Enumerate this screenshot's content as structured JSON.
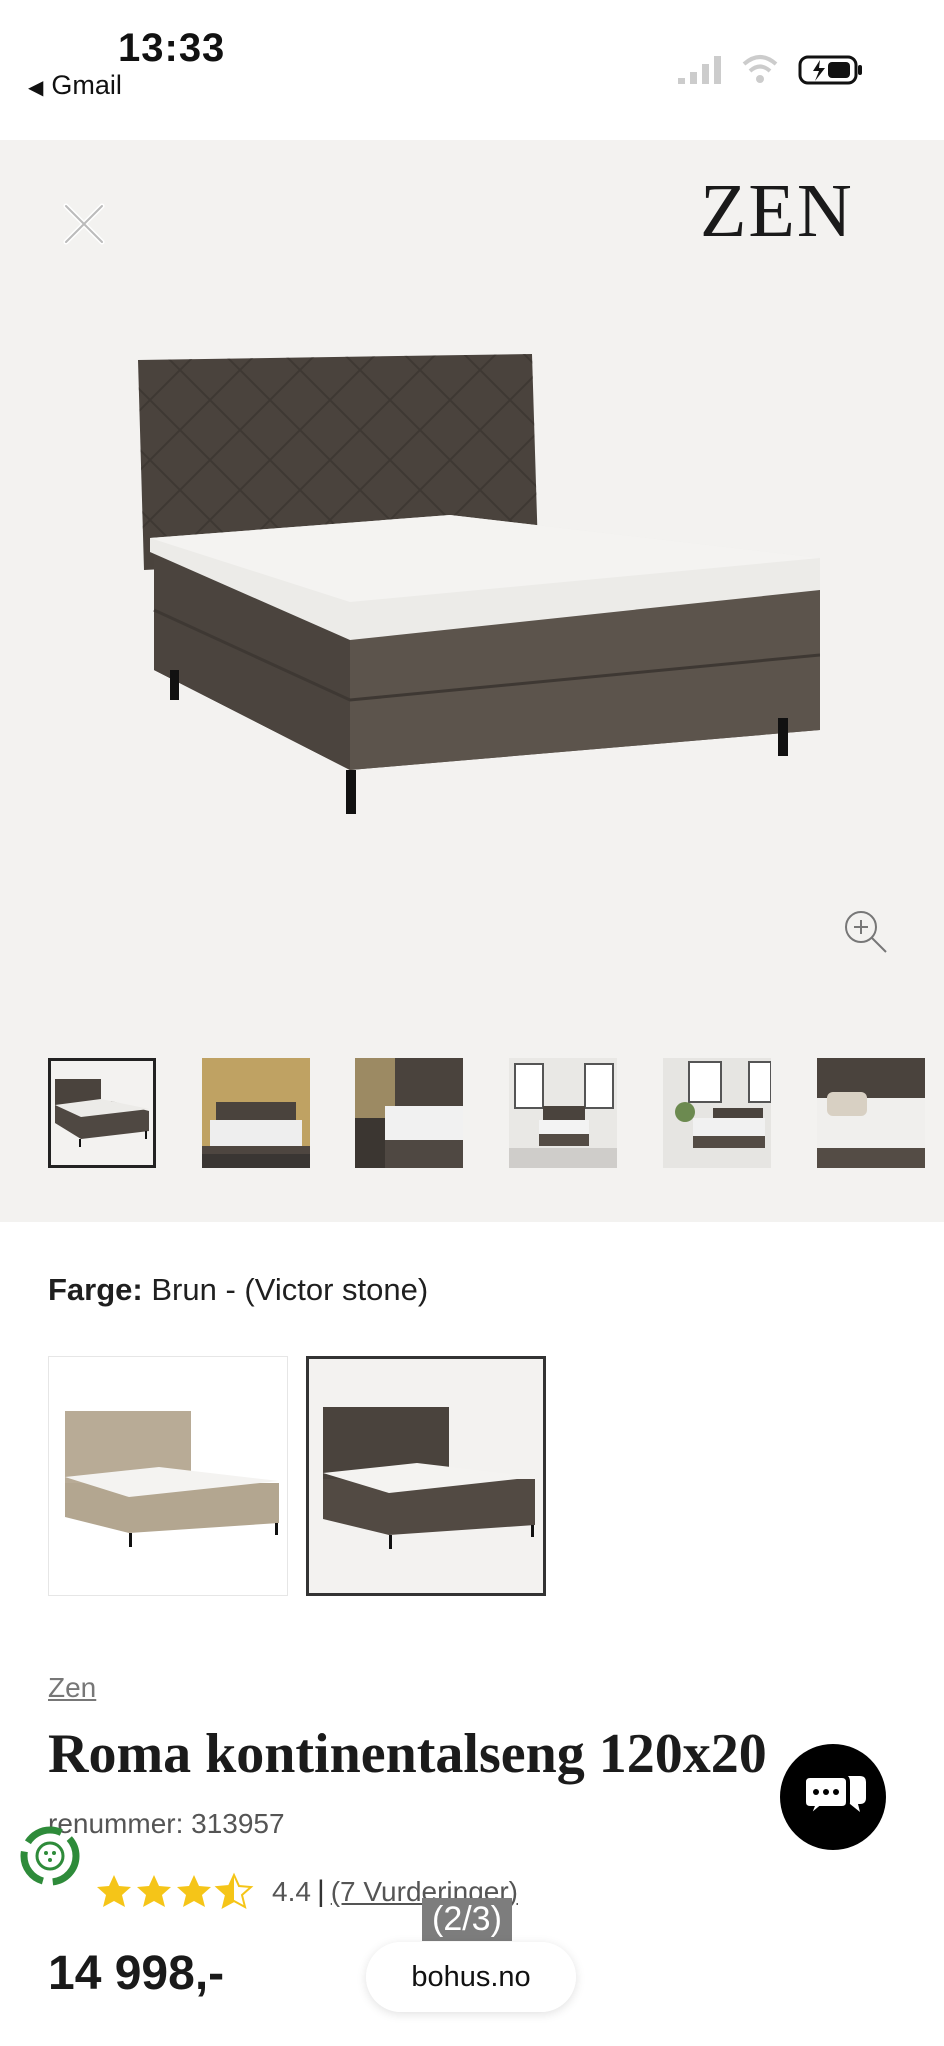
{
  "status_bar": {
    "time": "13:33",
    "back_app": "Gmail"
  },
  "gallery": {
    "brand_logo": "ZEN",
    "thumbnail_count": 6,
    "selected_index": 0
  },
  "color": {
    "label": "Farge:",
    "value": "Brun - (Victor stone)",
    "options": [
      "beige",
      "brun"
    ],
    "selected_index": 1
  },
  "product": {
    "brand": "Zen",
    "title": "Roma kontinentalseng 120x20",
    "sku": "renummer: 313957",
    "rating": 4.4,
    "rating_text": "4.4",
    "separator": "|",
    "reviews": "(7 Vurderinger)",
    "price": "14 998,-"
  },
  "overlays": {
    "page_indicator": "(2/3)",
    "url": "bohus.no"
  },
  "colors": {
    "gallery_bg": "#f3f2f0",
    "bed_brown": "#4a433d",
    "bed_beige": "#b8ab96",
    "star": "#f5c518",
    "chat_bg": "#000000",
    "eco_green": "#2e8b3a"
  }
}
